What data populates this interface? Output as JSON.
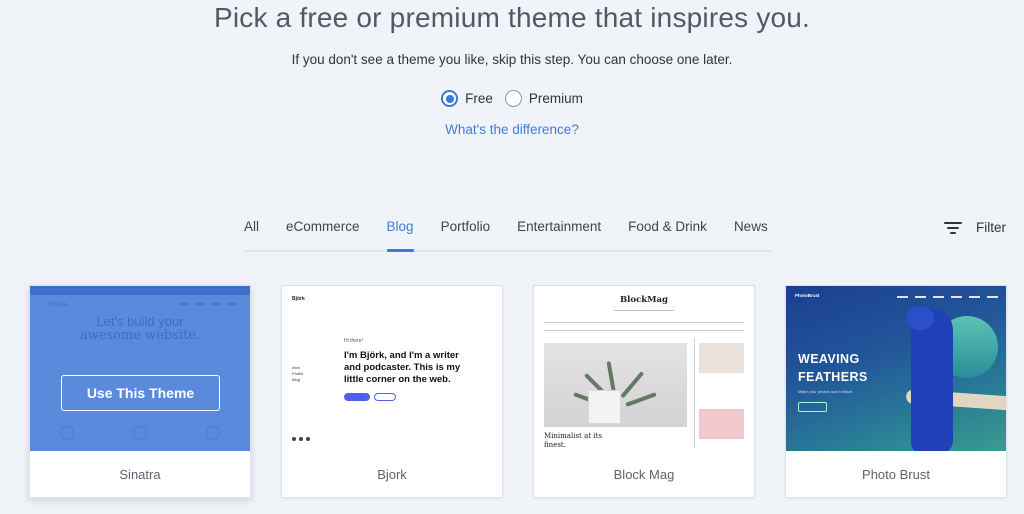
{
  "header": {
    "title": "Pick a free or premium theme that inspires you.",
    "subtitle": "If you don't see a theme you like, skip this step. You can choose one later."
  },
  "pricing": {
    "options": [
      {
        "label": "Free",
        "selected": true
      },
      {
        "label": "Premium",
        "selected": false
      }
    ],
    "difference_link": "What's the difference?"
  },
  "tabs": [
    {
      "label": "All",
      "active": false
    },
    {
      "label": "eCommerce",
      "active": false
    },
    {
      "label": "Blog",
      "active": true
    },
    {
      "label": "Portfolio",
      "active": false
    },
    {
      "label": "Entertainment",
      "active": false
    },
    {
      "label": "Food & Drink",
      "active": false
    },
    {
      "label": "News",
      "active": false
    }
  ],
  "filter": {
    "label": "Filter",
    "icon": "filter-icon"
  },
  "themes": [
    {
      "name": "Sinatra",
      "hovered": true,
      "cta": "Use This Theme",
      "preview": {
        "hero_line1": "Let's build your",
        "hero_line2": "awesome website.",
        "brand": "Sinatra"
      }
    },
    {
      "name": "Bjork",
      "preview": {
        "brand": "Björk",
        "greeting": "Hi there!",
        "intro": "I'm Björk, and I'm a writer and podcaster. This is my little corner on the web.",
        "side_links": "Intro\nProfile\nBlog"
      }
    },
    {
      "name": "Block Mag",
      "preview": {
        "brand": "BlockMag",
        "headline": "Minimalist at its finest."
      }
    },
    {
      "name": "Photo Brust",
      "preview": {
        "brand": "PhotoBrust",
        "headline": "WEAVING FEATHERS",
        "tagline": "Make your photos look brilliant"
      }
    }
  ],
  "colors": {
    "accent": "#3c78d8",
    "background": "#f0f3f8",
    "link": "#3c7fd6"
  }
}
